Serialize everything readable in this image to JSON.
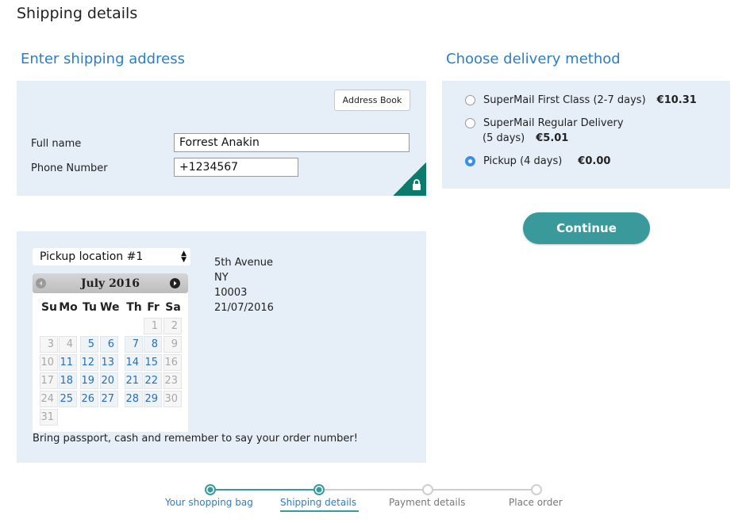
{
  "page_title": "Shipping details",
  "address": {
    "title": "Enter shipping address",
    "address_book_label": "Address Book",
    "full_name_label": "Full name",
    "full_name_value": "Forrest Anakin",
    "phone_label": "Phone Number",
    "phone_value": "+1234567"
  },
  "delivery": {
    "title": "Choose delivery method",
    "options": [
      {
        "label": "SuperMail First Class (2-7 days)",
        "price": "€10.31",
        "selected": false
      },
      {
        "label": "SuperMail Regular Delivery",
        "label_line2": "(5 days)",
        "price": "€5.01",
        "selected": false
      },
      {
        "label": "Pickup (4 days)",
        "price": "€0.00",
        "selected": true
      }
    ],
    "continue_label": "Continue"
  },
  "pickup": {
    "location_selected": "Pickup location #1",
    "address_lines": [
      "5th Avenue",
      "NY",
      "10003",
      "21/07/2016"
    ],
    "note": "Bring passport, cash and remember to say your order number!",
    "calendar": {
      "month_label": "July 2016",
      "weekdays": [
        "Su",
        "Mo",
        "Tu",
        "We",
        "Th",
        "Fr",
        "Sa"
      ],
      "weeks": [
        [
          "",
          "",
          "",
          "",
          "",
          "1",
          "2"
        ],
        [
          "3",
          "4",
          "5",
          "6",
          "7",
          "8",
          "9"
        ],
        [
          "10",
          "11",
          "12",
          "13",
          "14",
          "15",
          "16"
        ],
        [
          "17",
          "18",
          "19",
          "20",
          "21",
          "22",
          "23"
        ],
        [
          "24",
          "25",
          "26",
          "27",
          "28",
          "29",
          "30"
        ],
        [
          "31",
          "",
          "",
          "",
          "",
          "",
          ""
        ]
      ],
      "selectable_days": [
        "5",
        "6",
        "7",
        "8",
        "11",
        "12",
        "13",
        "14",
        "15",
        "18",
        "19",
        "20",
        "21",
        "22",
        "25",
        "26",
        "27",
        "28",
        "29"
      ]
    }
  },
  "steps": [
    {
      "label": "Your shopping bag",
      "status": "done"
    },
    {
      "label": "Shipping details",
      "status": "current"
    },
    {
      "label": "Payment details",
      "status": "todo"
    },
    {
      "label": "Place order",
      "status": "todo"
    }
  ],
  "colors": {
    "accent": "#2a7fc4",
    "teal": "#3a9a9b",
    "panel": "#e6eef8",
    "lock_corner": "#0c7a6d"
  }
}
